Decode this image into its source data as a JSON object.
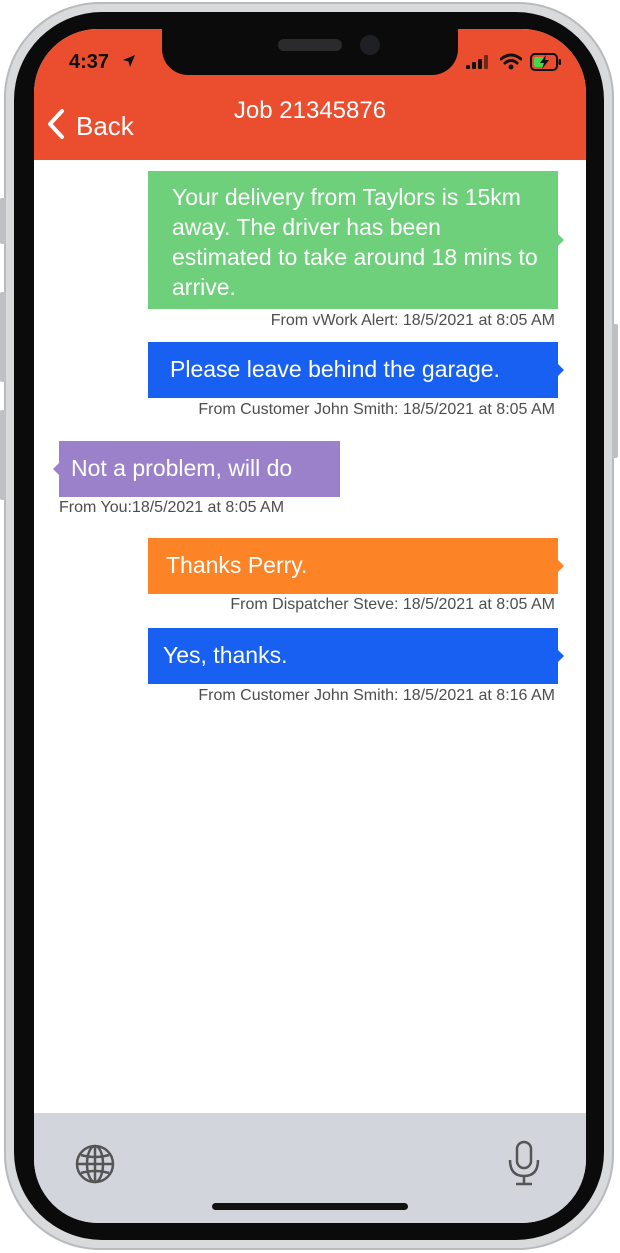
{
  "status_bar": {
    "time": "4:37"
  },
  "nav": {
    "back_label": "Back",
    "title": "Job 21345876"
  },
  "messages": [
    {
      "text": "Your delivery from Taylors is 15km away. The driver has been estimated to take around 18 mins to arrive.",
      "meta": "From vWork Alert: 18/5/2021 at 8:05 AM",
      "color": "#6fd07c",
      "side": "right"
    },
    {
      "text": "Please leave behind the garage.",
      "meta": "From Customer John Smith: 18/5/2021 at 8:05 AM",
      "color": "#1760f2",
      "side": "right"
    },
    {
      "text": "Not a problem, will do",
      "meta": "From You:18/5/2021 at 8:05 AM",
      "color": "#9b81ca",
      "side": "left"
    },
    {
      "text": "Thanks Perry.",
      "meta": "From Dispatcher Steve: 18/5/2021 at 8:05 AM",
      "color": "#fc8426",
      "side": "right"
    },
    {
      "text": "Yes, thanks.",
      "meta": "From Customer John Smith: 18/5/2021 at 8:16 AM",
      "color": "#1760f2",
      "side": "right"
    }
  ],
  "toolbar": {
    "left_icon": "globe-icon",
    "right_icon": "microphone-icon"
  },
  "colors": {
    "header": "#ea4e2f",
    "toolbar": "#d2d5db"
  }
}
